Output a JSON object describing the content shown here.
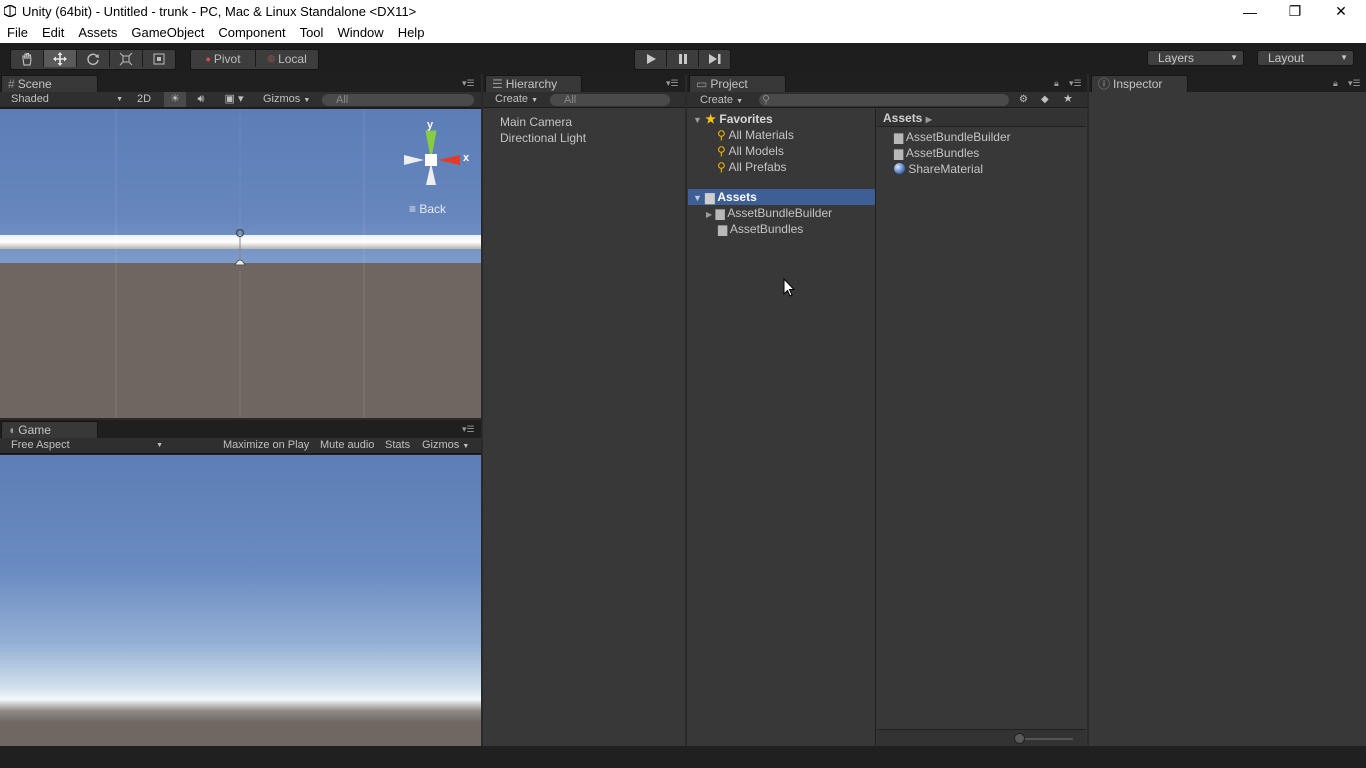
{
  "window": {
    "title": "Unity (64bit) - Untitled - trunk - PC, Mac & Linux Standalone <DX11>",
    "minimize": "—",
    "restore": "❐",
    "close": "✕"
  },
  "menu": [
    "File",
    "Edit",
    "Assets",
    "GameObject",
    "Component",
    "Tool",
    "Window",
    "Help"
  ],
  "toolbar": {
    "transform_tools": [
      "hand-icon",
      "move-icon",
      "rotate-icon",
      "scale-icon",
      "rect-icon"
    ],
    "pivot_label": "Pivot",
    "local_label": "Local",
    "layers_label": "Layers",
    "layout_label": "Layout"
  },
  "scene": {
    "tab_label": "Scene",
    "shading": "Shaded",
    "mode_2d": "2D",
    "gizmos_label": "Gizmos",
    "search_placeholder": "All",
    "gizmo_y": "y",
    "gizmo_x": "x",
    "back_label": "Back"
  },
  "game": {
    "tab_label": "Game",
    "aspect": "Free Aspect",
    "maximize_on_play": "Maximize on Play",
    "mute_audio": "Mute audio",
    "stats": "Stats",
    "gizmos_label": "Gizmos"
  },
  "hierarchy": {
    "tab_label": "Hierarchy",
    "create_label": "Create",
    "search_placeholder": "All",
    "items": [
      "Main Camera",
      "Directional Light"
    ]
  },
  "project": {
    "tab_label": "Project",
    "create_label": "Create",
    "favorites_label": "Favorites",
    "favorites": [
      "All Materials",
      "All Models",
      "All Prefabs"
    ],
    "assets_label": "Assets",
    "asset_folders": [
      "AssetBundleBuilder",
      "AssetBundles"
    ],
    "breadcrumb": "Assets",
    "assets_list": [
      {
        "name": "AssetBundleBuilder",
        "icon": "folder-icon"
      },
      {
        "name": "AssetBundles",
        "icon": "folder-icon"
      },
      {
        "name": "ShareMaterial",
        "icon": "material-sphere-icon"
      }
    ]
  },
  "inspector": {
    "tab_label": "Inspector"
  },
  "colors": {
    "selection": "#3e5f96",
    "panel_bg": "#383838",
    "toolbar_bg": "#1e1e1e"
  }
}
